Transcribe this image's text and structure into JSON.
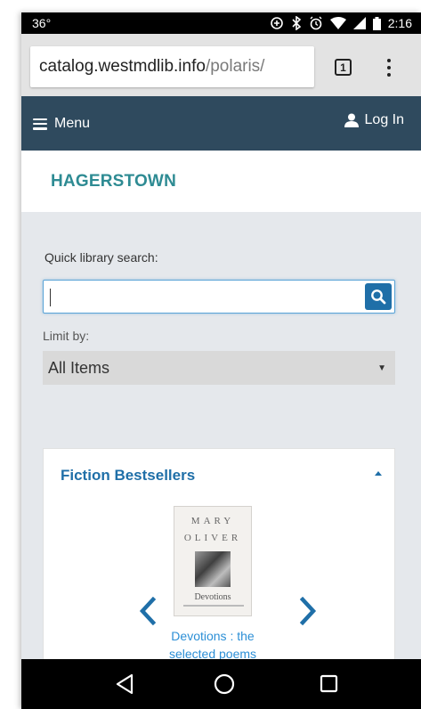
{
  "status_bar": {
    "temperature": "36°",
    "time": "2:16"
  },
  "browser": {
    "url_domain": "catalog.westmdlib.info",
    "url_path": "/polaris/",
    "tab_count": "1"
  },
  "nav": {
    "menu_label": "Menu",
    "login_label": "Log In"
  },
  "library": {
    "name": "HAGERSTOWN"
  },
  "search": {
    "label": "Quick library search:",
    "value": "",
    "limit_label": "Limit by:",
    "limit_selected": "All Items"
  },
  "bestsellers": {
    "title": "Fiction Bestsellers",
    "book": {
      "title": "Devotions : the selected poems",
      "cover_author_line1": "MARY",
      "cover_author_line2": "OLIVER",
      "cover_title": "Devotions"
    }
  },
  "colors": {
    "nav_bg": "#2f4a5e",
    "library_name": "#2e8b93",
    "accent_blue": "#1f6fa8",
    "link_blue": "#2c8fd6"
  }
}
